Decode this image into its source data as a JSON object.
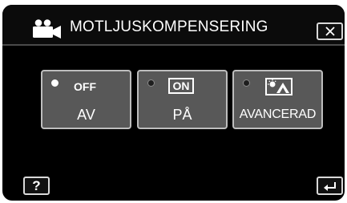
{
  "header": {
    "title": "MOTLJUSKOMPENSERING",
    "icon": "movie-camera-icon",
    "close_icon": "close-icon"
  },
  "options": [
    {
      "badge": "OFF",
      "label": "AV",
      "selected": true
    },
    {
      "badge": "ON",
      "label": "PÅ",
      "selected": false
    },
    {
      "badge_icon": "backlight-enhanced-icon",
      "label": "AVANCERAD",
      "selected": false
    }
  ],
  "footer": {
    "help_label": "?",
    "back_icon": "return-arrow-icon"
  },
  "colors": {
    "background": "#000000",
    "option_bg": "#585858",
    "option_border": "#bdbdbd",
    "text": "#ffffff"
  }
}
